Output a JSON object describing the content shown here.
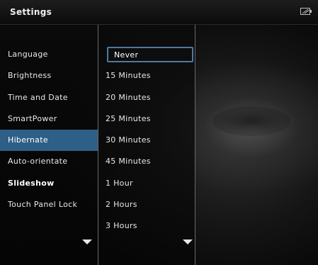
{
  "header": {
    "title": "Settings",
    "status_icon": "battery-icon"
  },
  "settings_menu": {
    "items": [
      {
        "label": "Language",
        "state": "normal"
      },
      {
        "label": "Brightness",
        "state": "normal"
      },
      {
        "label": "Time and Date",
        "state": "normal"
      },
      {
        "label": "SmartPower",
        "state": "normal"
      },
      {
        "label": "Hibernate",
        "state": "selected"
      },
      {
        "label": "Auto-orientate",
        "state": "normal"
      },
      {
        "label": "Slideshow",
        "state": "bold"
      },
      {
        "label": "Touch Panel Lock",
        "state": "normal"
      }
    ],
    "scroll_icon": "chevron-down-icon"
  },
  "hibernate_options": {
    "items": [
      {
        "label": "Never",
        "state": "focused"
      },
      {
        "label": "15 Minutes",
        "state": "normal"
      },
      {
        "label": "20 Minutes",
        "state": "normal"
      },
      {
        "label": "25 Minutes",
        "state": "normal"
      },
      {
        "label": "30 Minutes",
        "state": "normal"
      },
      {
        "label": "45 Minutes",
        "state": "normal"
      },
      {
        "label": "1 Hour",
        "state": "normal"
      },
      {
        "label": "2 Hours",
        "state": "normal"
      },
      {
        "label": "3 Hours",
        "state": "normal"
      }
    ],
    "scroll_icon": "chevron-down-icon"
  },
  "colors": {
    "selection": "#2e5f87",
    "focus_border": "#4d7aa1",
    "background": "#000000",
    "text": "#e8e8e8"
  }
}
